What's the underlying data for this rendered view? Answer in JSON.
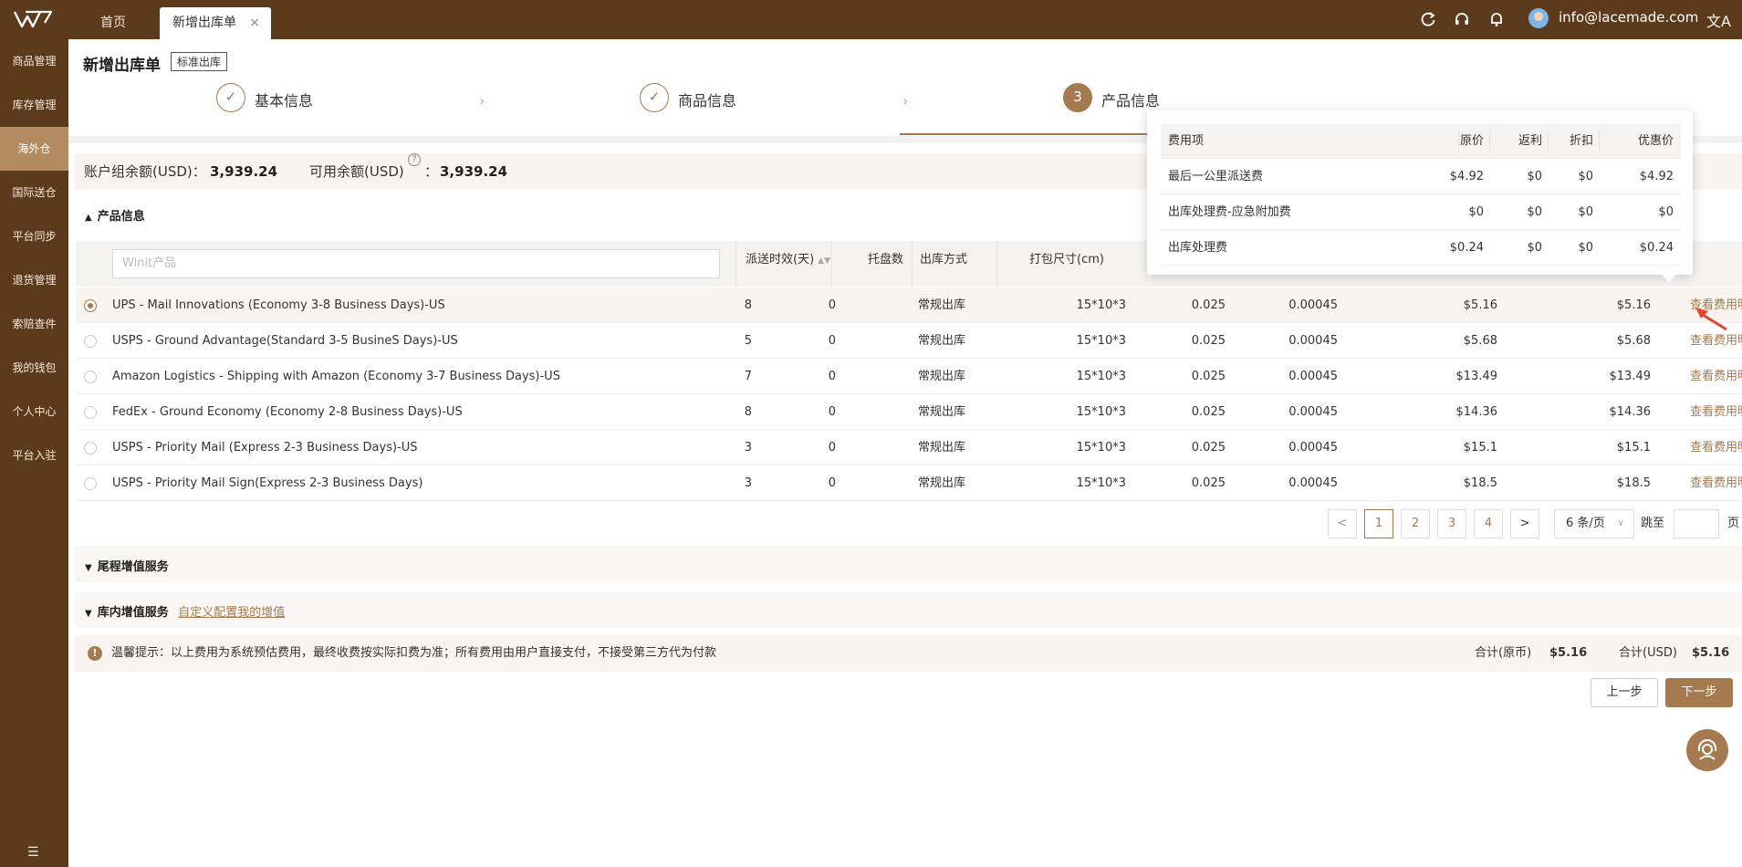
{
  "topbar": {
    "tabs": [
      {
        "label": "首页"
      },
      {
        "label": "新增出库单"
      }
    ],
    "tab_close": "×",
    "email": "info@lacemade.com",
    "lang": "文A"
  },
  "sidebar": {
    "items": [
      {
        "label": "商品管理"
      },
      {
        "label": "库存管理"
      },
      {
        "label": "海外仓",
        "active": true
      },
      {
        "label": "国际送仓"
      },
      {
        "label": "平台同步"
      },
      {
        "label": "退货管理"
      },
      {
        "label": "索赔查件"
      },
      {
        "label": "我的钱包"
      },
      {
        "label": "个人中心"
      },
      {
        "label": "平台入驻"
      }
    ],
    "collapse": "☰"
  },
  "page": {
    "title": "新增出库单",
    "badge": "标准出库"
  },
  "steps": [
    {
      "label": "基本信息",
      "mark": "✓"
    },
    {
      "label": "商品信息",
      "mark": "✓"
    },
    {
      "label": "产品信息",
      "mark": "3"
    }
  ],
  "balance": {
    "group_label": "账户组余额(USD)：",
    "group_value": "3,939.24",
    "avail_label": "可用余额(USD)",
    "avail_colon": "：",
    "avail_value": "3,939.24",
    "help": "?"
  },
  "product_section": {
    "title": "产品信息"
  },
  "table": {
    "search_placeholder": "Winit产品",
    "headers": {
      "time": "派送时效(天)",
      "pallets": "托盘数",
      "method": "出库方式",
      "size": "打包尺寸(cm)"
    },
    "rows": [
      {
        "name": "UPS - Mail Innovations (Economy 3-8 Business Days)-US",
        "days": "8",
        "pallets": "0",
        "method": "常规出库",
        "size": "15*10*3",
        "weight": "0.025",
        "volume": "0.00045",
        "price": "$5.16",
        "total": "$5.16",
        "link": "查看费用明细",
        "selected": true
      },
      {
        "name": "USPS - Ground Advantage(Standard 3-5 BusineS Days)-US",
        "days": "5",
        "pallets": "0",
        "method": "常规出库",
        "size": "15*10*3",
        "weight": "0.025",
        "volume": "0.00045",
        "price": "$5.68",
        "total": "$5.68",
        "link": "查看费用明细"
      },
      {
        "name": "Amazon Logistics - Shipping with Amazon (Economy 3-7 Business Days)-US",
        "days": "7",
        "pallets": "0",
        "method": "常规出库",
        "size": "15*10*3",
        "weight": "0.025",
        "volume": "0.00045",
        "price": "$13.49",
        "total": "$13.49",
        "link": "查看费用明细"
      },
      {
        "name": "FedEx - Ground Economy (Economy 2-8 Business Days)-US",
        "days": "8",
        "pallets": "0",
        "method": "常规出库",
        "size": "15*10*3",
        "weight": "0.025",
        "volume": "0.00045",
        "price": "$14.36",
        "total": "$14.36",
        "link": "查看费用明细"
      },
      {
        "name": "USPS - Priority Mail (Express 2-3 Business Days)-US",
        "days": "3",
        "pallets": "0",
        "method": "常规出库",
        "size": "15*10*3",
        "weight": "0.025",
        "volume": "0.00045",
        "price": "$15.1",
        "total": "$15.1",
        "link": "查看费用明细"
      },
      {
        "name": "USPS - Priority Mail Sign(Express 2-3 Business Days)",
        "days": "3",
        "pallets": "0",
        "method": "常规出库",
        "size": "15*10*3",
        "weight": "0.025",
        "volume": "0.00045",
        "price": "$18.5",
        "total": "$18.5",
        "link": "查看费用明细"
      }
    ]
  },
  "pagination": {
    "prev": "<",
    "next": ">",
    "pages": [
      "1",
      "2",
      "3",
      "4"
    ],
    "current": "1",
    "page_size": "6 条/页",
    "jump_label": "跳至",
    "page_suffix": "页"
  },
  "tail_section": {
    "title": "尾程增值服务"
  },
  "warehouse_section": {
    "title": "库内增值服务",
    "link": "自定义配置我的增值"
  },
  "notice": {
    "icon": "!",
    "text": "温馨提示：以上费用为系统预估费用，最终收费按实际扣费为准；所有费用由用户直接支付，不接受第三方代为付款",
    "total_orig_label": "合计(原币)",
    "total_orig_value": "$5.16",
    "total_usd_label": "合计(USD)",
    "total_usd_value": "$5.16"
  },
  "buttons": {
    "prev": "上一步",
    "next": "下一步"
  },
  "popover": {
    "headers": [
      "费用项",
      "原价",
      "返利",
      "折扣",
      "优惠价"
    ],
    "rows": [
      [
        "最后一公里派送费",
        "$4.92",
        "$0",
        "$0",
        "$4.92"
      ],
      [
        "出库处理费-应急附加费",
        "$0",
        "$0",
        "$0",
        "$0"
      ],
      [
        "出库处理费",
        "$0.24",
        "$0",
        "$0",
        "$0.24"
      ]
    ]
  },
  "colors": {
    "brand": "#5c3a1c",
    "accent": "#a67a4f",
    "annotation": "#e8432f"
  }
}
